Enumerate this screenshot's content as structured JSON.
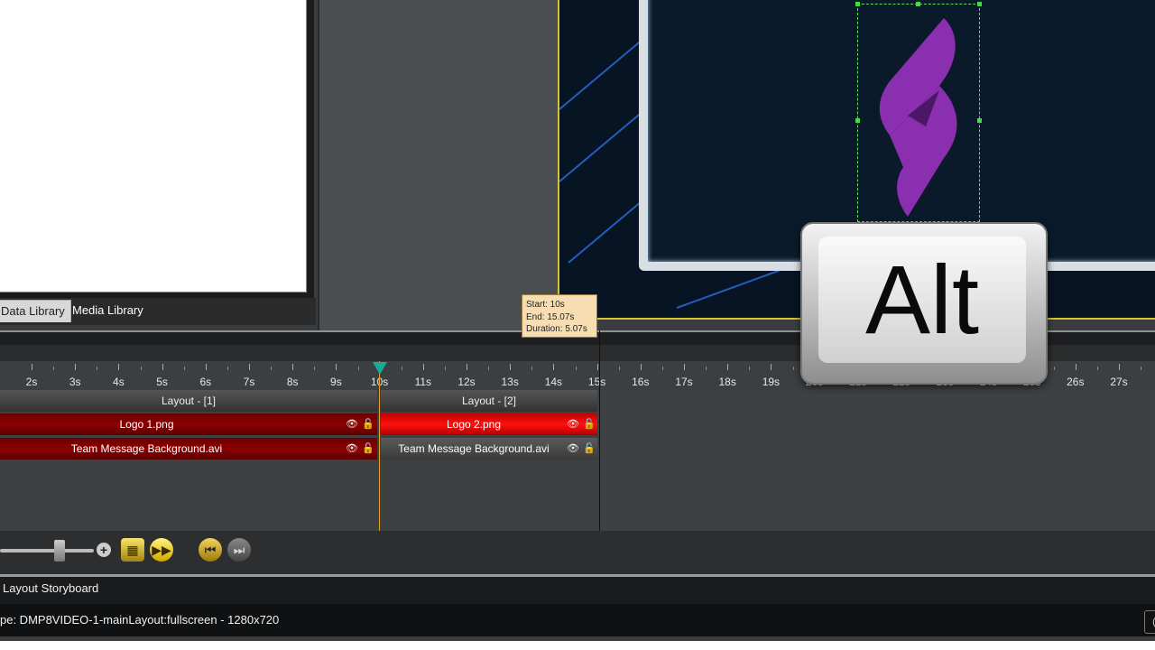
{
  "library_tabs": {
    "data_library": "Data Library",
    "media_library": "Media Library"
  },
  "tooltip": {
    "start": "Start: 10s",
    "end": "End: 15.07s",
    "duration": "Duration: 5.07s"
  },
  "ruler": {
    "labels": [
      "2s",
      "3s",
      "4s",
      "5s",
      "6s",
      "7s",
      "8s",
      "9s",
      "10s",
      "11s",
      "12s",
      "13s",
      "14s",
      "15s",
      "16s",
      "17s",
      "18s",
      "19s",
      "20s",
      "21s",
      "22s",
      "23s",
      "24s",
      "25s",
      "26s",
      "27s"
    ]
  },
  "tracks": {
    "layout1": "Layout - [1]",
    "layout2": "Layout - [2]",
    "clip1a": "Logo 1.png",
    "clip1b": "Team Message Background.avi",
    "clip2a": "Logo 2.png",
    "clip2b": "Team Message Background.avi"
  },
  "icons": {
    "eye": "eye-icon",
    "lock": "lock-icon",
    "zoom_plus": "plus-icon",
    "film": "film-icon",
    "fast_forward": "fast-forward-icon",
    "prev": "skip-back-icon",
    "next": "skip-forward-icon"
  },
  "status": {
    "panel_title": "Layout Storyboard",
    "info": "pe:  DMP8VIDEO-1-mainLayout:fullscreen - 1280x720"
  },
  "key_overlay": {
    "label": "Alt"
  },
  "colors": {
    "accent_yellow": "#d6c52a",
    "clip_red": "#ff1010",
    "playhead": "#e39b2a",
    "logo_purple": "#8a2fb0"
  }
}
